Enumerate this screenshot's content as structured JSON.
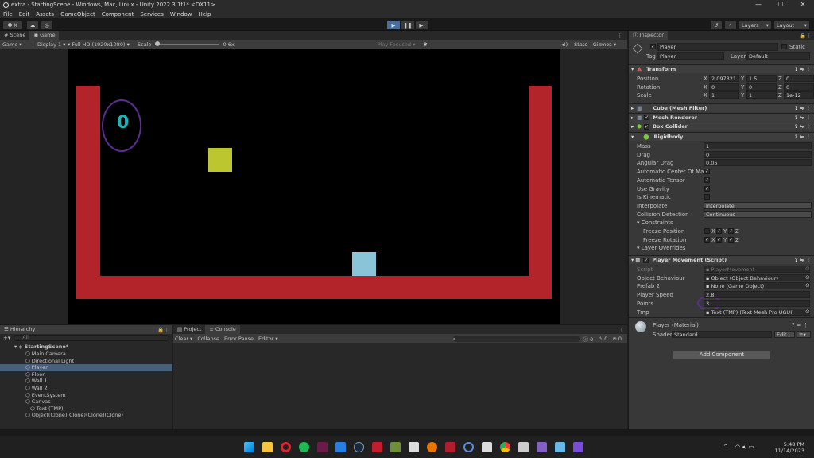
{
  "window": {
    "title": "extra - StartingScene - Windows, Mac, Linux - Unity 2022.3.1f1* <DX11>",
    "minimize": "—",
    "maximize": "☐",
    "close": "✕"
  },
  "menu": [
    "File",
    "Edit",
    "Assets",
    "GameObject",
    "Component",
    "Services",
    "Window",
    "Help"
  ],
  "toolbar": {
    "account": "X",
    "layers_label": "Layers",
    "layout_label": "Layout"
  },
  "scene_tabs": {
    "scene": "Scene",
    "game": "Game"
  },
  "game_bar": {
    "mode": "Game",
    "display": "Display 1",
    "resolution": "Full HD (1920x1080)",
    "scale_label": "Scale",
    "scale_value": "0.6x",
    "play_focused": "Play Focused",
    "stats": "Stats",
    "gizmos": "Gizmos"
  },
  "game_view": {
    "score_text": "0",
    "colors": {
      "wall": "#b3242a",
      "yellow": "#bcc62e",
      "player": "#89c4d8",
      "score": "#1fb2b9",
      "annotation": "#5c2d91"
    }
  },
  "hierarchy": {
    "title": "Hierarchy",
    "search_placeholder": "All",
    "scene_name": "StartingScene*",
    "items": [
      {
        "label": "Main Camera",
        "indent": 1
      },
      {
        "label": "Directional Light",
        "indent": 1
      },
      {
        "label": "Player",
        "indent": 1,
        "selected": true
      },
      {
        "label": "Floor",
        "indent": 1
      },
      {
        "label": "Wall 1",
        "indent": 1
      },
      {
        "label": "Wall 2",
        "indent": 1
      },
      {
        "label": "EventSystem",
        "indent": 1
      },
      {
        "label": "Canvas",
        "indent": 1
      },
      {
        "label": "Text (TMP)",
        "indent": 2
      },
      {
        "label": "Object(Clone)(Clone)(Clone)(Clone)",
        "indent": 1
      }
    ]
  },
  "console": {
    "project_tab": "Project",
    "console_tab": "Console",
    "clear": "Clear",
    "collapse": "Collapse",
    "error_pause": "Error Pause",
    "editor": "Editor",
    "count_info": "0",
    "count_warn": "0",
    "count_error": "0"
  },
  "inspector": {
    "title": "Inspector",
    "object_name": "Player",
    "static_label": "Static",
    "tag_label": "Tag",
    "tag_value": "Player",
    "layer_label": "Layer",
    "layer_value": "Default",
    "transform": {
      "title": "Transform",
      "position_label": "Position",
      "position": [
        "2.097321",
        "1.5",
        "0"
      ],
      "rotation_label": "Rotation",
      "rotation": [
        "0",
        "0",
        "0"
      ],
      "scale_label": "Scale",
      "scale": [
        "1",
        "1",
        "1e-12"
      ]
    },
    "components": [
      "Cube (Mesh Filter)",
      "Mesh Renderer",
      "Box Collider"
    ],
    "rigidbody": {
      "title": "Rigidbody",
      "mass_label": "Mass",
      "mass": "1",
      "drag_label": "Drag",
      "drag": "0",
      "angular_drag_label": "Angular Drag",
      "angular_drag": "0.05",
      "auto_com_label": "Automatic Center Of Mass",
      "auto_tensor_label": "Automatic Tensor",
      "use_gravity_label": "Use Gravity",
      "is_kinematic_label": "Is Kinematic",
      "interpolate_label": "Interpolate",
      "interpolate": "Interpolate",
      "collision_label": "Collision Detection",
      "collision": "Continuous",
      "constraints_label": "Constraints",
      "freeze_pos_label": "Freeze Position",
      "freeze_rot_label": "Freeze Rotation",
      "layer_overrides_label": "Layer Overrides"
    },
    "script": {
      "title": "Player Movement (Script)",
      "script_label": "Script",
      "script_value": "PlayerMovement",
      "object_behaviour_label": "Object Behaviour",
      "object_behaviour": "Object (Object Behaviour)",
      "prefab_label": "Prefab 2",
      "prefab": "None (Game Object)",
      "speed_label": "Player Speed",
      "speed": "2.8",
      "points_label": "Points",
      "points": "3",
      "tmp_label": "Tmp",
      "tmp": "Text (TMP) (Text Mesh Pro UGUI)"
    },
    "material": {
      "name": "Player (Material)",
      "shader_label": "Shader",
      "shader": "Standard",
      "edit": "Edit..."
    },
    "add_component": "Add Component"
  },
  "tray": {
    "time": "5:48 PM",
    "date": "11/14/2023"
  }
}
